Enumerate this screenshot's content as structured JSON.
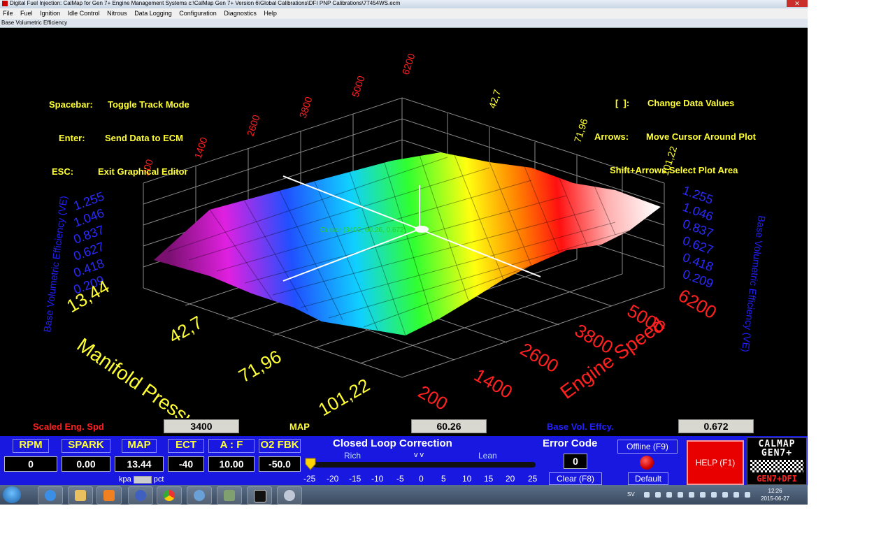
{
  "window": {
    "title": "Digital Fuel Injection:  CalMap for Gen 7+ Engine Management Systems     c:\\CalMap Gen 7+ Version 6\\Global Calibrations\\DFI PNP Calibrations\\77454WS.ecm",
    "close_label": "✕"
  },
  "menu": [
    "File",
    "Fuel",
    "Ignition",
    "Idle Control",
    "Nitrous",
    "Data Logging",
    "Configuration",
    "Diagnostics",
    "Help"
  ],
  "panel_title": "Base Volumetric Efficiency",
  "help_left": {
    "line1_key": "Spacebar:",
    "line1_text": "Toggle Track Mode",
    "line2_key": "Enter:",
    "line2_text": "Send Data to ECM",
    "line3_key": "ESC:",
    "line3_text": "Exit Graphical Editor"
  },
  "help_right": {
    "line1_key": "[  ]:",
    "line1_text": "Change Data Values",
    "line2_key": "Arrows:",
    "line2_text": "Move Cursor Around Plot",
    "line3_text": "Shift+Arrows Select Plot Area"
  },
  "plot": {
    "z_axis_label": "Base Volumetric Efficiency (VE)",
    "z_ticks": [
      "1.255",
      "1.046",
      "0.837",
      "0.627",
      "0.418",
      "0.209"
    ],
    "map_axis_label": "Manifold Pressure",
    "map_ticks": [
      "13,44",
      "42,7",
      "71,96",
      "101,22"
    ],
    "rpm_axis_label": "Engine Speed",
    "rpm_ticks": [
      "200",
      "1400",
      "2600",
      "3800",
      "5000",
      "6200"
    ],
    "cursor_label": "Cursor (3400, 60.26, 0.672)"
  },
  "readouts": {
    "rpm_label": "Scaled Eng. Spd",
    "rpm_value": "3400",
    "map_label": "MAP",
    "map_value": "60.26",
    "ve_label": "Base Vol. Effcy.",
    "ve_value": "0.672"
  },
  "gauges": [
    {
      "label": "RPM",
      "value": "0"
    },
    {
      "label": "SPARK",
      "value": "0.00"
    },
    {
      "label": "MAP",
      "value": "13.44"
    },
    {
      "label": "ECT",
      "value": "-40"
    },
    {
      "label": "A : F",
      "value": "10.00"
    },
    {
      "label": "O2 FBK",
      "value": "-50.0"
    }
  ],
  "units_toggle": {
    "left": "kpa",
    "right": "pct"
  },
  "closed_loop": {
    "title": "Closed Loop Correction",
    "rich": "Rich",
    "arrows": "v  v",
    "lean": "Lean",
    "ticks": [
      "-25",
      "-20",
      "-15",
      "-10",
      "-5",
      "0",
      "5",
      "10",
      "15",
      "20",
      "25"
    ]
  },
  "error": {
    "title": "Error Code",
    "value": "0",
    "clear_label": "Clear (F8)"
  },
  "offline_label": "Offline (F9)",
  "default_label": "Default",
  "help_button": "HELP (F1)",
  "logo": {
    "line1": "CALMAP",
    "line2": "GEN7+",
    "line3": "GEN7+DFI"
  },
  "taskbar": {
    "lang": "SV",
    "time": "12:26",
    "date": "2015-06-27"
  },
  "colors": {
    "dash_blue": "#1818e0",
    "yellow": "#ffff33",
    "rpm_red": "#ff2020",
    "z_blue": "#2020ff"
  }
}
